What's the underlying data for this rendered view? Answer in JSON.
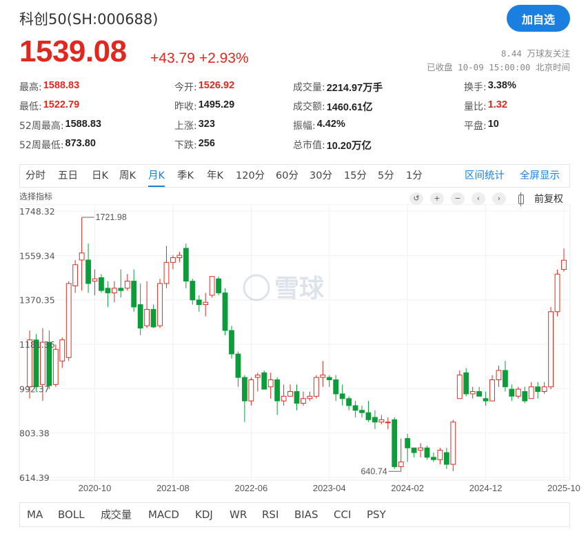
{
  "header": {
    "title": "科创50(SH:000688)",
    "follow_button": "加自选",
    "price": "1539.08",
    "change": "+43.79",
    "change_pct": "+2.93%",
    "followers": "8.44 万球友关注",
    "status": "已收盘 10-09 15:00:00 北京时间"
  },
  "quote": [
    {
      "label": "最高:",
      "value": "1588.83",
      "red": true
    },
    {
      "label": "今开:",
      "value": "1526.92",
      "red": true
    },
    {
      "label": "成交量:",
      "value": "2214.97万手",
      "red": false
    },
    {
      "label": "换手:",
      "value": "3.38%",
      "red": false
    },
    {
      "label": "最低:",
      "value": "1522.79",
      "red": true
    },
    {
      "label": "昨收:",
      "value": "1495.29",
      "red": false
    },
    {
      "label": "成交额:",
      "value": "1460.61亿",
      "red": false
    },
    {
      "label": "量比:",
      "value": "1.32",
      "red": true
    },
    {
      "label": "52周最高:",
      "value": "1588.83",
      "red": false
    },
    {
      "label": "上涨:",
      "value": "323",
      "red": false
    },
    {
      "label": "振幅:",
      "value": "4.42%",
      "red": false
    },
    {
      "label": "平盘:",
      "value": "10",
      "red": false
    },
    {
      "label": "52周最低:",
      "value": "873.80",
      "red": false
    },
    {
      "label": "下跌:",
      "value": "256",
      "red": false
    },
    {
      "label": "总市值:",
      "value": "10.20万亿",
      "red": false
    }
  ],
  "tabs": [
    "分时",
    "五日",
    "日K",
    "周K",
    "月K",
    "季K",
    "年K",
    "120分",
    "60分",
    "30分",
    "15分",
    "5分",
    "1分"
  ],
  "active_tab": "月K",
  "tab_actions": [
    "区间统计",
    "全屏显示"
  ],
  "indicator_select_label": "选择指标",
  "controls": [
    "↺",
    "+",
    "−",
    "‹",
    "›"
  ],
  "fuquan_label": "前复权",
  "watermark": "雪球",
  "indicators": [
    "MA",
    "BOLL",
    "成交量",
    "MACD",
    "KDJ",
    "WR",
    "RSI",
    "BIAS",
    "CCI",
    "PSY"
  ],
  "colors": {
    "up": "#e0281f",
    "down": "#0c9d3a",
    "accent": "#1b7fe0"
  },
  "chart_data": {
    "type": "candlestick",
    "y_ticks": [
      "1748.32",
      "1559.34",
      "1370.35",
      "1181.36",
      "992.37",
      "803.38",
      "614.39"
    ],
    "y_range": [
      614.39,
      1748.32
    ],
    "x_ticks": [
      "2020-10",
      "2021-08",
      "2022-06",
      "2023-04",
      "2024-02",
      "2024-12",
      "2025-10"
    ],
    "max_label": "1721.98",
    "min_label": "640.74",
    "candles": [
      [
        1000,
        1200,
        950,
        1240
      ],
      [
        1200,
        1000,
        980,
        1225
      ],
      [
        1010,
        1190,
        940,
        1250
      ],
      [
        1190,
        1005,
        990,
        1240
      ],
      [
        1010,
        1160,
        1000,
        1180
      ],
      [
        1110,
        1200,
        1080,
        1210
      ],
      [
        1125,
        1440,
        1110,
        1450
      ],
      [
        1430,
        1520,
        1400,
        1540
      ],
      [
        1540,
        1570,
        1410,
        1721.98
      ],
      [
        1540,
        1440,
        1400,
        1610
      ],
      [
        1450,
        1460,
        1390,
        1500
      ],
      [
        1465,
        1410,
        1400,
        1480
      ],
      [
        1420,
        1400,
        1340,
        1450
      ],
      [
        1400,
        1420,
        1360,
        1450
      ],
      [
        1420,
        1410,
        1380,
        1500
      ],
      [
        1420,
        1450,
        1410,
        1480
      ],
      [
        1450,
        1340,
        1320,
        1500
      ],
      [
        1350,
        1250,
        1220,
        1440
      ],
      [
        1260,
        1330,
        1250,
        1450
      ],
      [
        1330,
        1255,
        1250,
        1350
      ],
      [
        1260,
        1440,
        1250,
        1460
      ],
      [
        1440,
        1530,
        1420,
        1600
      ],
      [
        1530,
        1550,
        1500,
        1560
      ],
      [
        1550,
        1560,
        1530,
        1575
      ],
      [
        1590,
        1450,
        1420,
        1610
      ],
      [
        1450,
        1370,
        1350,
        1460
      ],
      [
        1370,
        1350,
        1320,
        1390
      ],
      [
        1350,
        1360,
        1300,
        1400
      ],
      [
        1390,
        1470,
        1380,
        1470
      ],
      [
        1460,
        1400,
        1390,
        1470
      ],
      [
        1400,
        1240,
        1220,
        1420
      ],
      [
        1240,
        1140,
        1120,
        1260
      ],
      [
        1140,
        1040,
        1000,
        1150
      ],
      [
        1040,
        940,
        850,
        1050
      ],
      [
        940,
        1030,
        920,
        1040
      ],
      [
        1040,
        1050,
        980,
        1060
      ],
      [
        1060,
        990,
        990,
        1070
      ],
      [
        1000,
        1030,
        950,
        1060
      ],
      [
        1030,
        940,
        880,
        1040
      ],
      [
        940,
        960,
        920,
        1010
      ],
      [
        960,
        980,
        980,
        1010
      ],
      [
        980,
        930,
        900,
        1010
      ],
      [
        930,
        950,
        920,
        980
      ],
      [
        950,
        960,
        940,
        980
      ],
      [
        960,
        1040,
        950,
        1050
      ],
      [
        1040,
        1050,
        1000,
        1110
      ],
      [
        1040,
        1030,
        1000,
        1050
      ],
      [
        1030,
        970,
        940,
        1050
      ],
      [
        970,
        950,
        920,
        1010
      ],
      [
        950,
        920,
        900,
        960
      ],
      [
        920,
        900,
        870,
        940
      ],
      [
        900,
        890,
        870,
        920
      ],
      [
        890,
        860,
        850,
        940
      ],
      [
        870,
        850,
        820,
        900
      ],
      [
        850,
        860,
        840,
        880
      ],
      [
        850,
        850,
        820,
        870
      ],
      [
        860,
        660,
        650,
        870
      ],
      [
        660,
        680,
        640,
        780
      ],
      [
        780,
        740,
        680,
        800
      ],
      [
        740,
        720,
        700,
        740
      ],
      [
        730,
        740,
        700,
        760
      ],
      [
        740,
        700,
        690,
        750
      ],
      [
        700,
        690,
        680,
        720
      ],
      [
        690,
        730,
        670,
        740
      ],
      [
        720,
        670,
        650,
        740
      ],
      [
        670,
        850,
        640.74,
        860
      ],
      [
        950,
        1050,
        970,
        1070
      ],
      [
        1060,
        970,
        960,
        1080
      ],
      [
        970,
        980,
        950,
        1000
      ],
      [
        980,
        960,
        960,
        1000
      ],
      [
        950,
        940,
        920,
        980
      ],
      [
        940,
        1030,
        940,
        1050
      ],
      [
        1030,
        1070,
        1000,
        1090
      ],
      [
        1070,
        1000,
        980,
        1110
      ],
      [
        990,
        960,
        940,
        1010
      ],
      [
        960,
        990,
        950,
        1000
      ],
      [
        980,
        940,
        930,
        1000
      ],
      [
        950,
        1000,
        950,
        1020
      ],
      [
        1000,
        980,
        950,
        1020
      ],
      [
        980,
        1000,
        970,
        1020
      ],
      [
        1000,
        1320,
        990,
        1340
      ],
      [
        1320,
        1480,
        1300,
        1500
      ],
      [
        1500,
        1539.08,
        1490,
        1588.83
      ]
    ]
  }
}
